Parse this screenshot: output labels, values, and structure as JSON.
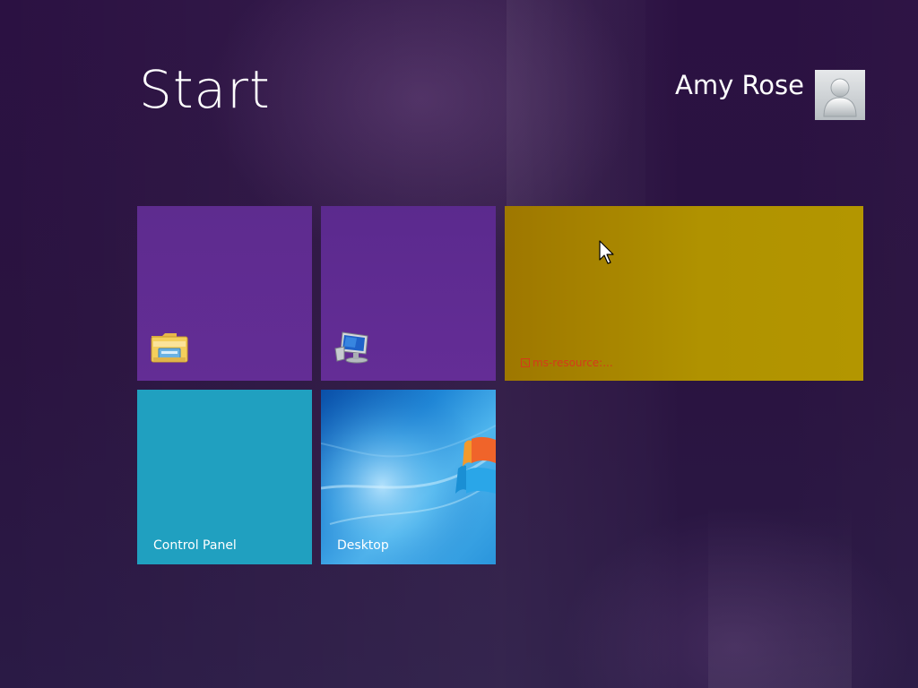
{
  "screen": {
    "title": "Start"
  },
  "user": {
    "name": "Amy Rose",
    "avatar_icon": "user-avatar-icon"
  },
  "tiles": [
    {
      "id": "explorer",
      "label": "",
      "icon": "folder-explorer-icon",
      "color": "#632d95"
    },
    {
      "id": "computer",
      "label": "",
      "icon": "computer-icon",
      "color": "#632d95"
    },
    {
      "id": "wide",
      "label": "ms-resource:...",
      "icon": "broken-image-icon",
      "color": "#b09200",
      "label_color": "#d43b1a"
    },
    {
      "id": "control-panel",
      "label": "Control Panel",
      "color": "#20a0c0"
    },
    {
      "id": "desktop",
      "label": "Desktop",
      "icon": "windows-logo-icon"
    }
  ],
  "colors": {
    "background": "#2a1240",
    "text": "#ffffff"
  },
  "cursor": "arrow-cursor-icon"
}
